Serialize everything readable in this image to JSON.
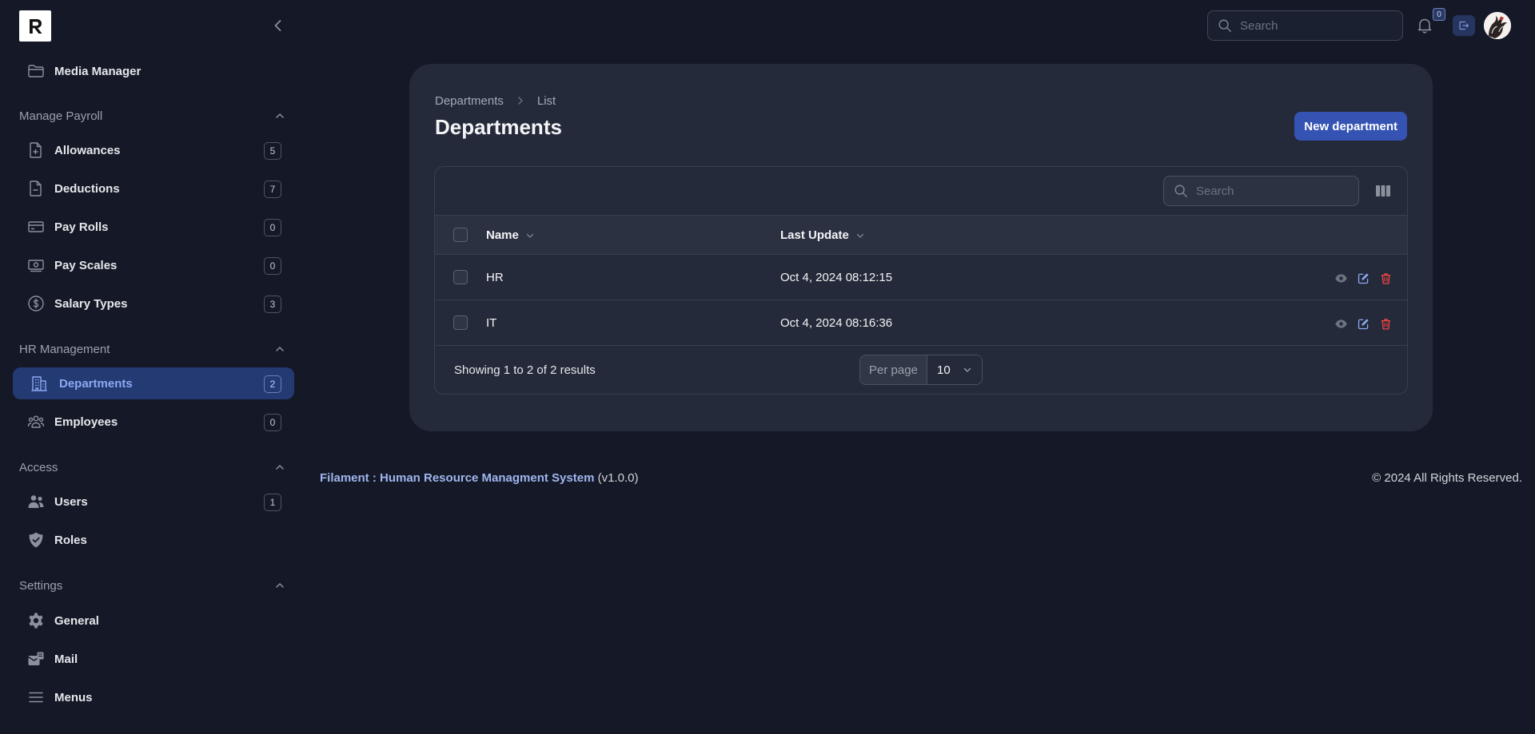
{
  "topbar": {
    "search_placeholder": "Search",
    "notification_count": "0"
  },
  "sidebar": {
    "top_items": [
      {
        "label": "Media Manager",
        "icon": "folder-icon"
      }
    ],
    "groups": [
      {
        "label": "Manage Payroll",
        "items": [
          {
            "label": "Allowances",
            "badge": "5",
            "icon": "document-plus-icon"
          },
          {
            "label": "Deductions",
            "badge": "7",
            "icon": "document-minus-icon"
          },
          {
            "label": "Pay Rolls",
            "badge": "0",
            "icon": "credit-card-icon"
          },
          {
            "label": "Pay Scales",
            "badge": "0",
            "icon": "banknotes-icon"
          },
          {
            "label": "Salary Types",
            "badge": "3",
            "icon": "currency-dollar-icon"
          }
        ]
      },
      {
        "label": "HR Management",
        "items": [
          {
            "label": "Departments",
            "badge": "2",
            "icon": "building-icon",
            "active": true
          },
          {
            "label": "Employees",
            "badge": "0",
            "icon": "user-group-icon"
          }
        ]
      },
      {
        "label": "Access",
        "items": [
          {
            "label": "Users",
            "badge": "1",
            "icon": "users-icon"
          },
          {
            "label": "Roles",
            "icon": "shield-check-icon"
          }
        ]
      },
      {
        "label": "Settings",
        "items": [
          {
            "label": "General",
            "icon": "cog-icon"
          },
          {
            "label": "Mail",
            "icon": "mail-icon"
          },
          {
            "label": "Menus",
            "icon": "bars-icon"
          }
        ]
      }
    ]
  },
  "page": {
    "breadcrumb": [
      "Departments",
      "List"
    ],
    "title": "Departments",
    "new_button": "New department"
  },
  "table": {
    "search_placeholder": "Search",
    "columns": [
      "Name",
      "Last Update"
    ],
    "rows": [
      {
        "name": "HR",
        "last_update": "Oct 4, 2024 08:12:15"
      },
      {
        "name": "IT",
        "last_update": "Oct 4, 2024 08:16:36"
      }
    ],
    "summary": "Showing 1 to 2 of 2 results",
    "per_page_label": "Per page",
    "per_page_value": "10"
  },
  "footer": {
    "brand": "Filament : Human Resource Managment System",
    "version": "(v1.0.0)",
    "copyright": "© 2024 All Rights Reserved."
  },
  "colors": {
    "background": "#151927",
    "card": "#252a3a",
    "primary": "#3553b3",
    "active_nav": "#243a73",
    "danger": "#ef4444"
  }
}
